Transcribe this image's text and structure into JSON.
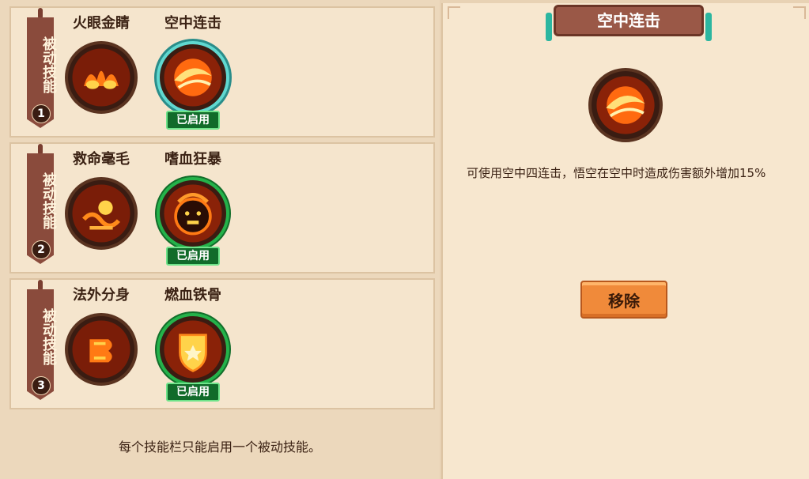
{
  "slots": [
    {
      "tag_label": "被动技能",
      "number": "1",
      "skills": [
        {
          "name": "火眼金睛",
          "icon": "fire-eyes-icon",
          "enabled": false
        },
        {
          "name": "空中连击",
          "icon": "air-combo-icon",
          "enabled": true,
          "badge": "已启用"
        }
      ]
    },
    {
      "tag_label": "被动技能",
      "number": "2",
      "skills": [
        {
          "name": "救命毫毛",
          "icon": "life-hair-icon",
          "enabled": false
        },
        {
          "name": "嗜血狂暴",
          "icon": "blood-rage-icon",
          "enabled": true,
          "badge": "已启用"
        }
      ]
    },
    {
      "tag_label": "被动技能",
      "number": "3",
      "skills": [
        {
          "name": "法外分身",
          "icon": "clone-icon",
          "enabled": false
        },
        {
          "name": "燃血铁骨",
          "icon": "iron-bone-shield-icon",
          "enabled": true,
          "badge": "已启用"
        }
      ]
    }
  ],
  "tip": "每个技能栏只能启用一个被动技能。",
  "detail": {
    "title": "空中连击",
    "icon": "air-combo-icon",
    "description": "可使用空中四连击，悟空在空中时造成伤害额外增加15%",
    "remove_label": "移除"
  },
  "colors": {
    "enabled_ring": "#24b24a",
    "selected_ring": "#60d8d0",
    "button": "#f08a3a",
    "tag_banner": "#8a4b3c"
  }
}
